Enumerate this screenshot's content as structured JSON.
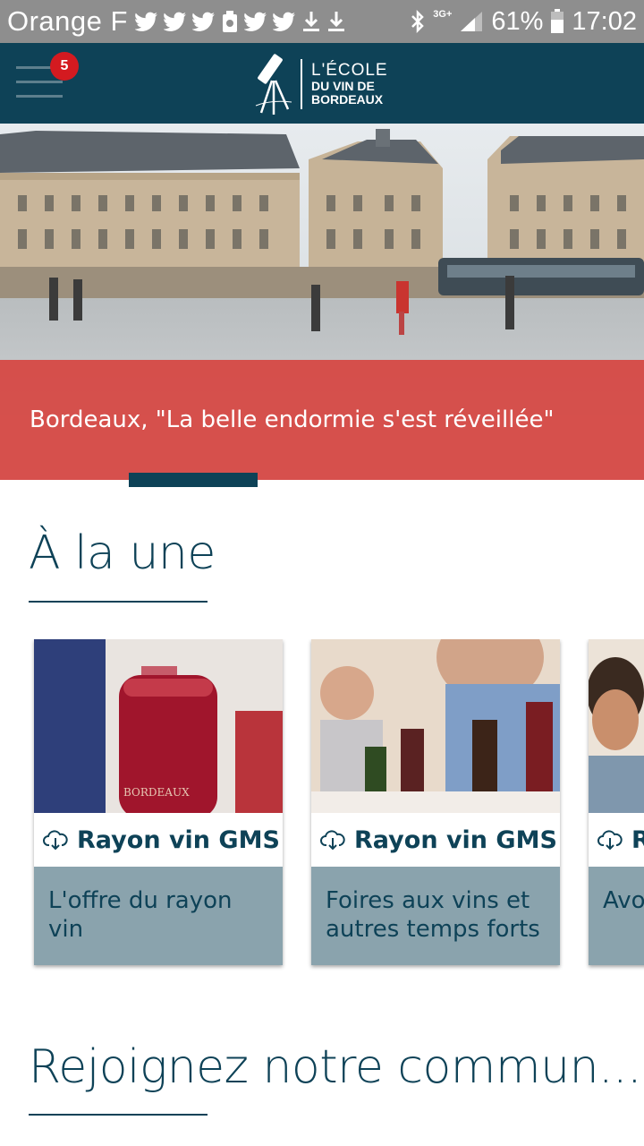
{
  "status_bar": {
    "carrier": "Orange F",
    "network": "3G+",
    "battery": "61%",
    "time": "17:02"
  },
  "header": {
    "notification_count": "5",
    "logo": {
      "line1": "L'ÉCOLE",
      "line2": "DU VIN DE",
      "line3": "BORDEAUX"
    }
  },
  "hero": {
    "caption": "Bordeaux, \"La belle endormie s'est réveillée\""
  },
  "featured": {
    "title": "À la une",
    "cards": [
      {
        "title": "Rayon vin GMS",
        "description": "L'offre du rayon vin",
        "icon": "cloud-download-icon"
      },
      {
        "title": "Rayon vin GMS",
        "description": "Foires aux vins et autres temps forts",
        "icon": "cloud-download-icon"
      },
      {
        "title": "Rayon vin GMS",
        "description": "Avoir une offre",
        "icon": "cloud-download-icon"
      }
    ]
  },
  "community": {
    "title": "Rejoignez notre commun..."
  },
  "colors": {
    "primary": "#0e4257",
    "hero_caption": "#d64642",
    "card_body": "#8aa3ad",
    "badge": "#d41a20",
    "status_bar": "#8e8e8e"
  }
}
